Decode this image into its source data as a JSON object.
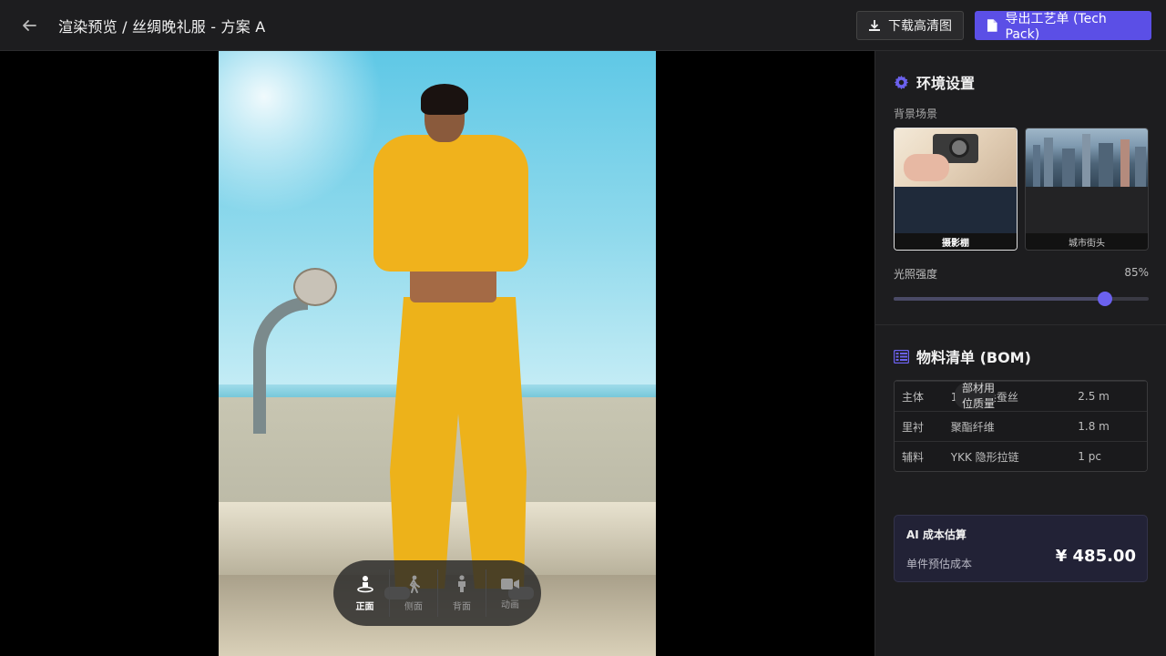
{
  "header": {
    "title": "渲染预览 / 丝绸晚礼服 - 方案 A",
    "download_label": "下载高清图",
    "export_label": "导出工艺单 (Tech Pack)"
  },
  "view_switcher": {
    "items": [
      {
        "label": "正面",
        "icon": "front-view-icon",
        "active": true
      },
      {
        "label": "侧面",
        "icon": "walking-person-icon",
        "active": false
      },
      {
        "label": "背面",
        "icon": "standing-person-icon",
        "active": false
      },
      {
        "label": "动画",
        "icon": "video-camera-icon",
        "active": false
      }
    ]
  },
  "environment": {
    "title": "环境设置",
    "background_label": "背景场景",
    "scenes": [
      {
        "label": "摄影棚",
        "selected": true
      },
      {
        "label": "城市街头",
        "selected": false
      }
    ],
    "lighting_label": "光照强度",
    "lighting_value": "85%",
    "lighting_level": 0.83
  },
  "bom": {
    "title": "物料清单 (BOM)",
    "columns": [
      "部位",
      "材质",
      "用量"
    ],
    "rows": [
      [
        "主体",
        "100% 桑蚕丝",
        "2.5 m"
      ],
      [
        "里衬",
        "聚酯纤维",
        "1.8 m"
      ],
      [
        "辅料",
        "YKK 隐形拉链",
        "1 pc"
      ]
    ]
  },
  "cost": {
    "title": "AI 成本估算",
    "label": "单件预估成本",
    "value": "¥ 485.00"
  },
  "colors": {
    "accent": "#5b4fe6",
    "panel_bg": "#1d1d1f",
    "canvas_bg": "#000000"
  }
}
